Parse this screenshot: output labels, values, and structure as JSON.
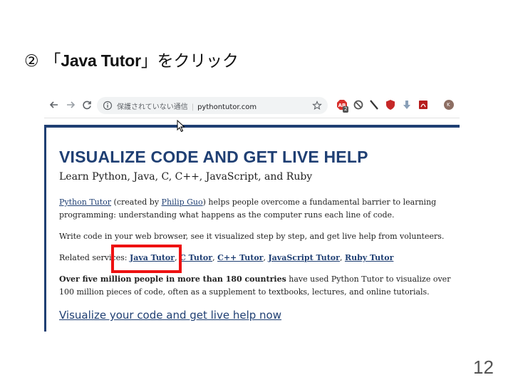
{
  "slide": {
    "title_num": "②",
    "title_open": "「",
    "title_bold": "Java Tutor",
    "title_close": "」をクリック",
    "page_number": "12"
  },
  "browser": {
    "security_text": "保護されていない通信",
    "separator": "|",
    "url": "pythontutor.com",
    "profile_initial": "K",
    "ext_badge": "2"
  },
  "page": {
    "headline": "VISUALIZE CODE AND GET LIVE HELP",
    "subhead": "Learn Python, Java, C, C++, JavaScript, and Ruby",
    "p1": {
      "link1": "Python Tutor",
      "text1": " (created by ",
      "link2": "Philip Guo",
      "text2": ") helps people overcome a fundamental barrier to learning programming: understanding what happens as the computer runs each line of code."
    },
    "p2": "Write code in your web browser, see it visualized step by step, and get live help from volunteers.",
    "related": {
      "label": "Related services: ",
      "items": [
        "Java Tutor",
        "C Tutor",
        "C++ Tutor",
        "JavaScript Tutor",
        "Ruby Tutor"
      ],
      "sep": ", "
    },
    "p4": {
      "bold": "Over five million people in more than 180 countries",
      "rest": " have used Python Tutor to visualize over 100 million pieces of code, often as a supplement to textbooks, lectures, and online tutorials."
    },
    "cta": "Visualize your code and get live help now"
  },
  "colors": {
    "brand_navy": "#1f3f73",
    "highlight_red": "#ee1111"
  },
  "icons": [
    "back-icon",
    "forward-icon",
    "reload-icon",
    "info-icon",
    "star-icon",
    "adblock-icon",
    "block-icon",
    "pen-icon",
    "ublock-icon",
    "download-icon",
    "pdf-icon",
    "profile-icon",
    "cursor-icon"
  ]
}
